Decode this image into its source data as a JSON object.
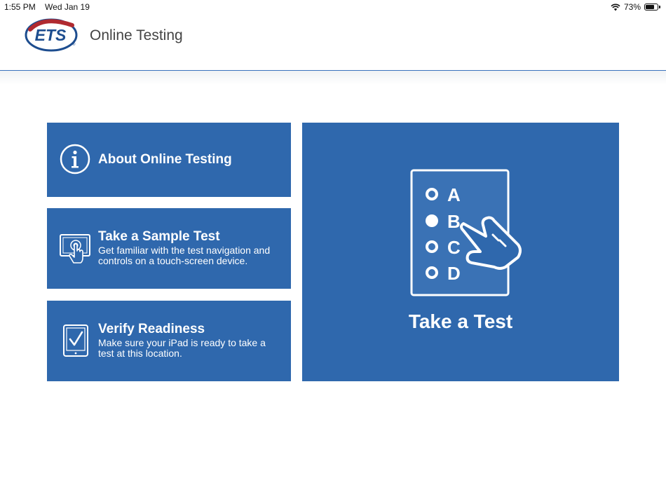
{
  "status_bar": {
    "time": "1:55 PM",
    "date": "Wed Jan 19",
    "battery_percent": "73%",
    "battery_level": 0.73
  },
  "header": {
    "logo_text": "ETS",
    "title": "Online Testing"
  },
  "tiles": {
    "about": {
      "title": "About Online Testing",
      "icon": "info-icon"
    },
    "sample": {
      "title": "Take a Sample Test",
      "description": "Get familiar with the test navigation and controls on a touch-screen device.",
      "icon": "touch-tablet-icon"
    },
    "verify": {
      "title": "Verify Readiness",
      "description": "Make sure your iPad is ready to take a test at this location.",
      "icon": "tablet-check-icon"
    },
    "test": {
      "title": "Take a Test",
      "icon": "answer-sheet-icon",
      "options": [
        "A",
        "B",
        "C",
        "D"
      ]
    }
  },
  "colors": {
    "tile_blue": "#2f68ad",
    "header_rule": "#3b73bd",
    "logo_red": "#b02a30",
    "logo_navy": "#1d4d8f"
  }
}
